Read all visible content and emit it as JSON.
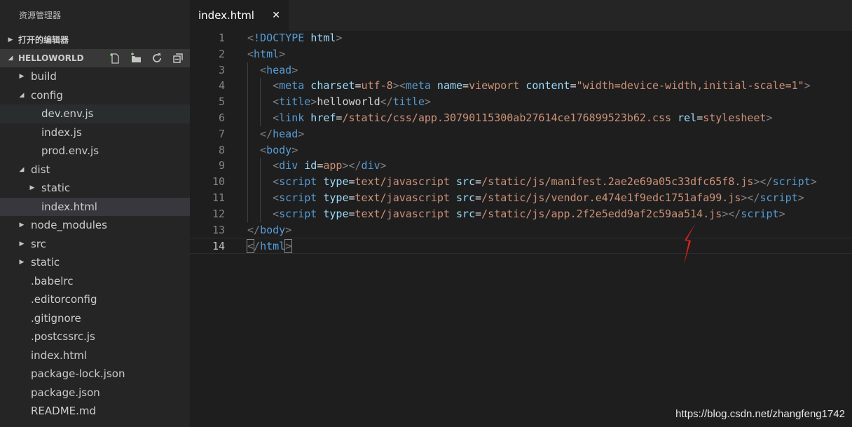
{
  "sidebar": {
    "header": "资源管理器",
    "open_editors": "打开的编辑器",
    "project": "HELLOWORLD",
    "actions": [
      "new-file-icon",
      "new-folder-icon",
      "refresh-icon",
      "collapse-all-icon"
    ],
    "tree": [
      {
        "label": "build",
        "type": "folder",
        "depth": 1,
        "expanded": false
      },
      {
        "label": "config",
        "type": "folder",
        "depth": 1,
        "expanded": true
      },
      {
        "label": "dev.env.js",
        "type": "file",
        "depth": 2,
        "state": "hover"
      },
      {
        "label": "index.js",
        "type": "file",
        "depth": 2
      },
      {
        "label": "prod.env.js",
        "type": "file",
        "depth": 2
      },
      {
        "label": "dist",
        "type": "folder",
        "depth": 1,
        "expanded": true
      },
      {
        "label": "static",
        "type": "folder",
        "depth": 2,
        "expanded": false
      },
      {
        "label": "index.html",
        "type": "file",
        "depth": 2,
        "state": "selected"
      },
      {
        "label": "node_modules",
        "type": "folder",
        "depth": 1,
        "expanded": false
      },
      {
        "label": "src",
        "type": "folder",
        "depth": 1,
        "expanded": false
      },
      {
        "label": "static",
        "type": "folder",
        "depth": 1,
        "expanded": false
      },
      {
        "label": ".babelrc",
        "type": "file",
        "depth": 1
      },
      {
        "label": ".editorconfig",
        "type": "file",
        "depth": 1
      },
      {
        "label": ".gitignore",
        "type": "file",
        "depth": 1
      },
      {
        "label": ".postcssrc.js",
        "type": "file",
        "depth": 1
      },
      {
        "label": "index.html",
        "type": "file",
        "depth": 1
      },
      {
        "label": "package-lock.json",
        "type": "file",
        "depth": 1
      },
      {
        "label": "package.json",
        "type": "file",
        "depth": 1
      },
      {
        "label": "README.md",
        "type": "file",
        "depth": 1
      }
    ]
  },
  "tab": {
    "label": "index.html",
    "close": "✕"
  },
  "editor": {
    "current_line": 14,
    "lines": [
      {
        "n": 1,
        "indent": 0,
        "tokens": [
          [
            "br",
            "<"
          ],
          [
            "doc",
            "!DOCTYPE "
          ],
          [
            "attr",
            "html"
          ],
          [
            "br",
            ">"
          ]
        ]
      },
      {
        "n": 2,
        "indent": 0,
        "tokens": [
          [
            "br",
            "<"
          ],
          [
            "tag",
            "html"
          ],
          [
            "br",
            ">"
          ]
        ]
      },
      {
        "n": 3,
        "indent": 1,
        "tokens": [
          [
            "br",
            "<"
          ],
          [
            "tag",
            "head"
          ],
          [
            "br",
            ">"
          ]
        ]
      },
      {
        "n": 4,
        "indent": 2,
        "tokens": [
          [
            "br",
            "<"
          ],
          [
            "tag",
            "meta"
          ],
          [
            "txt",
            " "
          ],
          [
            "attr",
            "charset"
          ],
          [
            "txt",
            "="
          ],
          [
            "val",
            "utf-8"
          ],
          [
            "br",
            "><"
          ],
          [
            "tag",
            "meta"
          ],
          [
            "txt",
            " "
          ],
          [
            "attr",
            "name"
          ],
          [
            "txt",
            "="
          ],
          [
            "val",
            "viewport"
          ],
          [
            "txt",
            " "
          ],
          [
            "attr",
            "content"
          ],
          [
            "txt",
            "="
          ],
          [
            "str",
            "\"width=device-width,initial-scale=1\""
          ],
          [
            "br",
            ">"
          ]
        ]
      },
      {
        "n": 5,
        "indent": 2,
        "tokens": [
          [
            "br",
            "<"
          ],
          [
            "tag",
            "title"
          ],
          [
            "br",
            ">"
          ],
          [
            "txt",
            "helloworld"
          ],
          [
            "br",
            "</"
          ],
          [
            "tag",
            "title"
          ],
          [
            "br",
            ">"
          ]
        ]
      },
      {
        "n": 6,
        "indent": 2,
        "tokens": [
          [
            "br",
            "<"
          ],
          [
            "tag",
            "link"
          ],
          [
            "txt",
            " "
          ],
          [
            "attr",
            "href"
          ],
          [
            "txt",
            "="
          ],
          [
            "val",
            "/static/css/app.30790115300ab27614ce176899523b62.css"
          ],
          [
            "txt",
            " "
          ],
          [
            "attr",
            "rel"
          ],
          [
            "txt",
            "="
          ],
          [
            "val",
            "stylesheet"
          ],
          [
            "br",
            ">"
          ]
        ]
      },
      {
        "n": 7,
        "indent": 1,
        "tokens": [
          [
            "br",
            "</"
          ],
          [
            "tag",
            "head"
          ],
          [
            "br",
            ">"
          ]
        ]
      },
      {
        "n": 8,
        "indent": 1,
        "tokens": [
          [
            "br",
            "<"
          ],
          [
            "tag",
            "body"
          ],
          [
            "br",
            ">"
          ]
        ]
      },
      {
        "n": 9,
        "indent": 2,
        "tokens": [
          [
            "br",
            "<"
          ],
          [
            "tag",
            "div"
          ],
          [
            "txt",
            " "
          ],
          [
            "attr",
            "id"
          ],
          [
            "txt",
            "="
          ],
          [
            "val",
            "app"
          ],
          [
            "br",
            "></"
          ],
          [
            "tag",
            "div"
          ],
          [
            "br",
            ">"
          ]
        ]
      },
      {
        "n": 10,
        "indent": 2,
        "tokens": [
          [
            "br",
            "<"
          ],
          [
            "tag",
            "script"
          ],
          [
            "txt",
            " "
          ],
          [
            "attr",
            "type"
          ],
          [
            "txt",
            "="
          ],
          [
            "val",
            "text/javascript"
          ],
          [
            "txt",
            " "
          ],
          [
            "attr",
            "src"
          ],
          [
            "txt",
            "="
          ],
          [
            "val",
            "/static/js/manifest.2ae2e69a05c33dfc65f8.js"
          ],
          [
            "br",
            "></"
          ],
          [
            "tag",
            "script"
          ],
          [
            "br",
            ">"
          ]
        ]
      },
      {
        "n": 11,
        "indent": 2,
        "tokens": [
          [
            "br",
            "<"
          ],
          [
            "tag",
            "script"
          ],
          [
            "txt",
            " "
          ],
          [
            "attr",
            "type"
          ],
          [
            "txt",
            "="
          ],
          [
            "val",
            "text/javascript"
          ],
          [
            "txt",
            " "
          ],
          [
            "attr",
            "src"
          ],
          [
            "txt",
            "="
          ],
          [
            "val",
            "/static/js/vendor.e474e1f9edc1751afa99.js"
          ],
          [
            "br",
            "></"
          ],
          [
            "tag",
            "script"
          ],
          [
            "br",
            ">"
          ]
        ]
      },
      {
        "n": 12,
        "indent": 2,
        "tokens": [
          [
            "br",
            "<"
          ],
          [
            "tag",
            "script"
          ],
          [
            "txt",
            " "
          ],
          [
            "attr",
            "type"
          ],
          [
            "txt",
            "="
          ],
          [
            "val",
            "text/javascript"
          ],
          [
            "txt",
            " "
          ],
          [
            "attr",
            "src"
          ],
          [
            "txt",
            "="
          ],
          [
            "val",
            "/static/js/app.2f2e5edd9af2c59aa514.js"
          ],
          [
            "br",
            "></"
          ],
          [
            "tag",
            "script"
          ],
          [
            "br",
            ">"
          ]
        ]
      },
      {
        "n": 13,
        "indent": 0,
        "tokens": [
          [
            "br",
            "</"
          ],
          [
            "tag",
            "body"
          ],
          [
            "br",
            ">"
          ]
        ]
      },
      {
        "n": 14,
        "indent": 0,
        "tokens": [
          [
            "brbox",
            "<"
          ],
          [
            "br",
            "/"
          ],
          [
            "tag",
            "html"
          ],
          [
            "brbox",
            ">"
          ]
        ]
      }
    ]
  },
  "colors": {
    "sidebar_bg": "#252526",
    "editor_bg": "#1e1e1e",
    "tag": "#569cd6",
    "attr": "#9cdcfe",
    "value": "#ce9178",
    "bracket": "#808080",
    "annotation_arrow": "#e02020"
  },
  "watermark": "https://blog.csdn.net/zhangfeng1742"
}
